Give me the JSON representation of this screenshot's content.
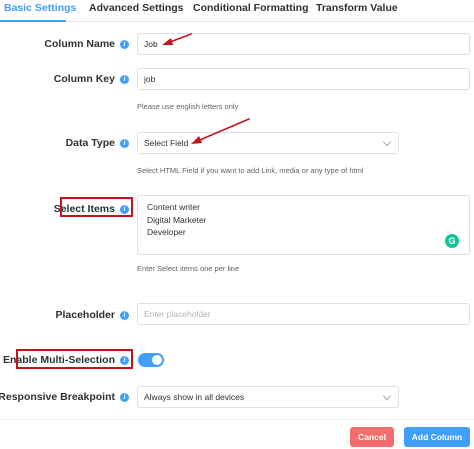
{
  "tabs": [
    {
      "label": "Basic Settings",
      "active": true
    },
    {
      "label": "Advanced Settings",
      "active": false
    },
    {
      "label": "Conditional Formatting",
      "active": false
    },
    {
      "label": "Transform Value",
      "active": false
    }
  ],
  "fields": {
    "column_name": {
      "label": "Column Name",
      "value": "Job"
    },
    "column_key": {
      "label": "Column Key",
      "value": "job",
      "help": "Please use english letters only"
    },
    "data_type": {
      "label": "Data Type",
      "value": "Select Field",
      "help": "Select HTML Field if you want to add Link, media or any type of html"
    },
    "select_items": {
      "label": "Select Items",
      "items": [
        "Content writer",
        "Digital Marketer",
        "Developer"
      ],
      "help": "Enter Select items one per line"
    },
    "placeholder": {
      "label": "Placeholder",
      "placeholder": "Enter placeholder"
    },
    "multi_selection": {
      "label": "Enable Multi-Selection",
      "enabled": true
    },
    "responsive_breakpoint": {
      "label": "Responsive Breakpoint",
      "value": "Always show in all devices"
    }
  },
  "buttons": {
    "cancel": "Cancel",
    "add": "Add Column"
  },
  "info_glyph": "i",
  "grammarly_glyph": "G",
  "colors": {
    "accent": "#409eff",
    "cancel": "#f56c6c",
    "annotation": "#c6131b",
    "grammarly": "#15c39a"
  },
  "icons": [
    "info-icon",
    "chevron-down-icon",
    "grammarly-icon",
    "annotation-arrow"
  ]
}
